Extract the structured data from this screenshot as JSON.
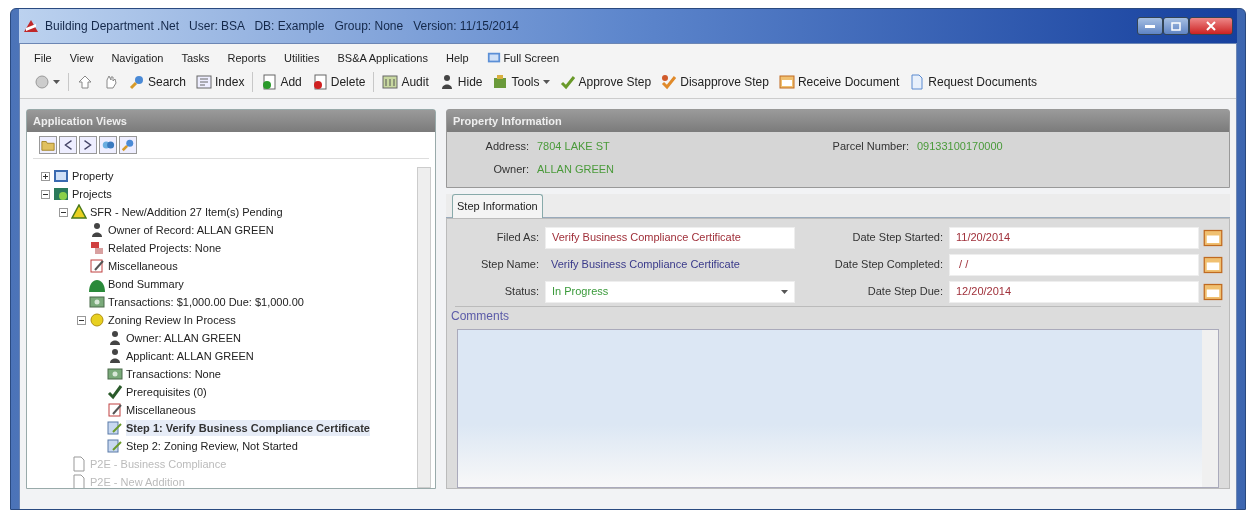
{
  "window": {
    "title": "Building Department .Net   User: BSA   DB: Example   Group: None   Version: 11/15/2014"
  },
  "menu": [
    {
      "label": "File"
    },
    {
      "label": "View"
    },
    {
      "label": "Navigation"
    },
    {
      "label": "Tasks"
    },
    {
      "label": "Reports"
    },
    {
      "label": "Utilities"
    },
    {
      "label": "BS&A Applications"
    },
    {
      "label": "Help"
    },
    {
      "label": "Full Screen",
      "kind": "screen"
    }
  ],
  "toolbar": [
    [
      {
        "kind": "circle",
        "dropdown": true
      }
    ],
    [
      {
        "kind": "up"
      },
      {
        "kind": "hand"
      },
      {
        "kind": "search",
        "label": "Search"
      },
      {
        "kind": "index",
        "label": "Index"
      }
    ],
    [
      {
        "kind": "add",
        "label": "Add"
      },
      {
        "kind": "delete",
        "label": "Delete"
      }
    ],
    [
      {
        "kind": "audit",
        "label": "Audit"
      },
      {
        "kind": "person",
        "label": "Hide"
      },
      {
        "kind": "tools",
        "label": "Tools",
        "dropdown": true
      },
      {
        "kind": "approve",
        "label": "Approve Step"
      },
      {
        "kind": "disapprove",
        "label": "Disapprove Step"
      },
      {
        "kind": "receive",
        "label": "Receive Document"
      },
      {
        "kind": "request",
        "label": "Request Documents"
      }
    ]
  ],
  "sidebar": {
    "title": "Application Views",
    "tools": [
      {
        "kind": "folder"
      },
      {
        "kind": "collapse"
      },
      {
        "kind": "expand"
      },
      {
        "kind": "link"
      },
      {
        "kind": "search"
      }
    ],
    "tree": [
      {
        "label": "Property",
        "kind": "property",
        "expanded": false
      },
      {
        "label": "Projects",
        "kind": "projects",
        "expanded": true,
        "children": [
          {
            "label": "SFR - New/Addition 27 Item(s) Pending",
            "kind": "warning",
            "expanded": true,
            "children": [
              {
                "label": "Owner of Record: ALLAN GREEN",
                "kind": "person"
              },
              {
                "label": "Related Projects: None",
                "kind": "related"
              },
              {
                "label": "Miscellaneous",
                "kind": "note"
              },
              {
                "label": "Bond Summary",
                "kind": "bond"
              },
              {
                "label": "Transactions: $1,000.00 Due: $1,000.00",
                "kind": "money"
              },
              {
                "label": "Zoning Review In Process",
                "kind": "pending",
                "expanded": true,
                "children": [
                  {
                    "label": "Owner: ALLAN GREEN",
                    "kind": "person"
                  },
                  {
                    "label": "Applicant: ALLAN GREEN",
                    "kind": "person"
                  },
                  {
                    "label": "Transactions: None",
                    "kind": "money"
                  },
                  {
                    "label": "Prerequisites (0)",
                    "kind": "check"
                  },
                  {
                    "label": "Miscellaneous",
                    "kind": "note"
                  },
                  {
                    "label": "Step 1: Verify Business Compliance Certificate",
                    "kind": "step",
                    "selected": true
                  },
                  {
                    "label": "Step 2: Zoning Review, Not Started",
                    "kind": "step",
                    "selected": false
                  }
                ]
              }
            ]
          },
          {
            "label": "P2E - Business Compliance",
            "kind": "document",
            "disabled": true
          },
          {
            "label": "P2E - New Addition",
            "kind": "document",
            "disabled": true
          }
        ]
      }
    ]
  },
  "property": {
    "title": "Property Information",
    "fields": [
      {
        "label": "Address:",
        "value": "7804 LAKE ST"
      },
      {
        "label": "Parcel Number:",
        "value": "09133100170000"
      },
      {
        "label": "Owner:",
        "value": "ALLAN GREEN"
      }
    ]
  },
  "tabs": [
    {
      "label": "Step Information",
      "selected": true
    }
  ],
  "step": {
    "filed_as": {
      "label": "Filed As:",
      "value": "Verify Business Compliance Certificate"
    },
    "step_name": {
      "label": "Step Name:",
      "value": "Verify Business Compliance Certificate"
    },
    "status": {
      "label": "Status:",
      "value": "In Progress"
    },
    "dates": [
      {
        "label": "Date Step Started:",
        "value": "11/20/2014"
      },
      {
        "label": "Date Step Completed:",
        "value": " / /"
      },
      {
        "label": "Date Step Due:",
        "value": "12/20/2014"
      }
    ],
    "comments": {
      "label": "Comments"
    }
  }
}
